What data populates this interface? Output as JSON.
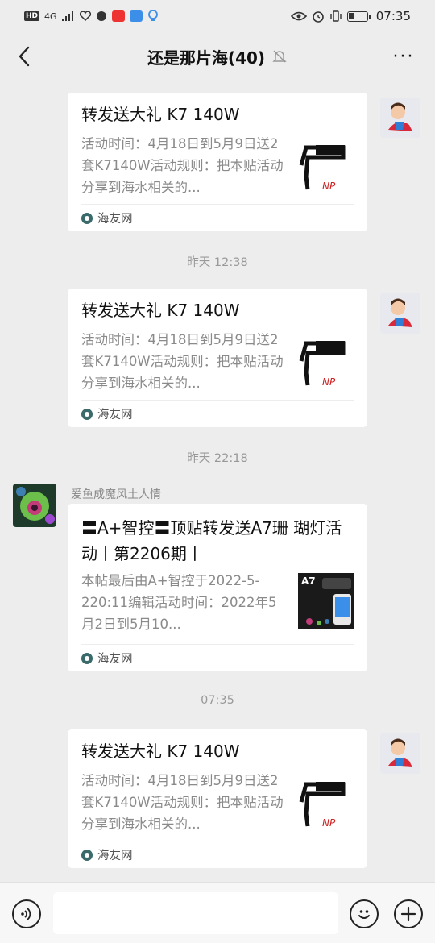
{
  "status_bar": {
    "hd": "HD",
    "network": "4G",
    "time": "07:35"
  },
  "nav": {
    "title": "还是那片海(40)",
    "back_icon": "chevron-left-icon",
    "mute_icon": "bell-off-icon",
    "more_label": "···"
  },
  "messages": [
    {
      "title": "转发送大礼 K7 140W",
      "desc": "活动时间：4月18日到5月9日送2套K7140W活动规则：把本贴活动分享到海水相关的...",
      "source": "海友网"
    },
    {
      "timestamp": "昨天 12:38",
      "title": "转发送大礼 K7 140W",
      "desc": "活动时间：4月18日到5月9日送2套K7140W活动规则：把本贴活动分享到海水相关的...",
      "source": "海友网"
    },
    {
      "timestamp": "昨天 22:18",
      "sender": "爱鱼成魔风土人情",
      "title": "〓A+智控〓顶贴转发送A7珊 瑚灯活动丨第2206期丨",
      "desc": "本帖最后由A+智控于2022-5-220:11编辑活动时间：2022年5月2日到5月10...",
      "thumb_label": "A7",
      "source": "海友网"
    },
    {
      "timestamp": "07:35",
      "title": "转发送大礼 K7 140W",
      "desc": "活动时间：4月18日到5月9日送2套K7140W活动规则：把本贴活动分享到海水相关的...",
      "source": "海友网"
    }
  ],
  "thumb_brand": "NP",
  "input": {
    "placeholder": ""
  },
  "colors": {
    "background": "#ededed",
    "card": "#ffffff",
    "muted": "#8a8a8a"
  }
}
